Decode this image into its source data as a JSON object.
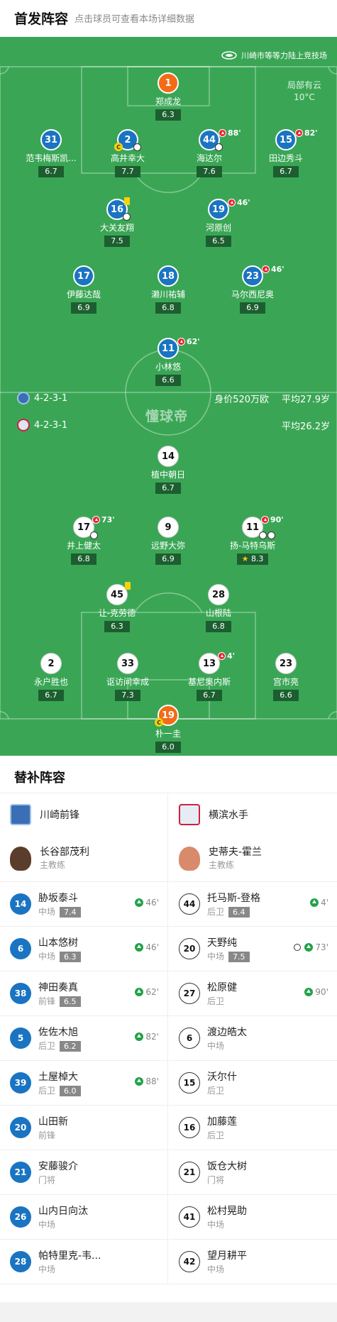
{
  "header": {
    "title": "首发阵容",
    "subtitle": "点击球员可查看本场详细数据"
  },
  "pitch": {
    "venue": "川崎市等等力陆上竞技场",
    "weather": "局部有云",
    "temperature": "10°C",
    "watermark": "懂球帝",
    "home_formation": "4-2-3-1",
    "home_value": "身价520万欧",
    "home_avg_age": "平均27.9岁",
    "away_formation": "4-2-3-1",
    "away_avg_age": "平均26.2岁"
  },
  "home_players": [
    {
      "number": "1",
      "name": "郑成龙",
      "rating": "6.3",
      "gk": true
    },
    {
      "number": "31",
      "name": "范韦梅斯凯...",
      "rating": "6.7"
    },
    {
      "number": "2",
      "name": "高井幸大",
      "rating": "7.7",
      "captain": true,
      "goals": 1
    },
    {
      "number": "44",
      "name": "海达尔",
      "rating": "7.6",
      "sub_off": "88'",
      "goals": 1
    },
    {
      "number": "15",
      "name": "田边秀斗",
      "rating": "6.7",
      "sub_off": "82'"
    },
    {
      "number": "16",
      "name": "大关友翔",
      "rating": "7.5",
      "yellow": true,
      "goals": 1
    },
    {
      "number": "19",
      "name": "河原创",
      "rating": "6.5",
      "sub_off": "46'"
    },
    {
      "number": "17",
      "name": "伊藤达哉",
      "rating": "6.9"
    },
    {
      "number": "18",
      "name": "濑川祐辅",
      "rating": "6.8"
    },
    {
      "number": "23",
      "name": "马尔西尼奥",
      "rating": "6.9",
      "sub_off": "46'"
    },
    {
      "number": "11",
      "name": "小林悠",
      "rating": "6.6",
      "sub_off": "62'"
    }
  ],
  "away_players": [
    {
      "number": "14",
      "name": "植中朝日",
      "rating": "6.7"
    },
    {
      "number": "17",
      "name": "井上健太",
      "rating": "6.8",
      "sub_off": "73'",
      "goals": 1
    },
    {
      "number": "9",
      "name": "远野大弥",
      "rating": "6.9"
    },
    {
      "number": "11",
      "name": "扬-马特乌斯",
      "rating": "8.3",
      "sub_off": "90'",
      "goals": 2,
      "star": true
    },
    {
      "number": "45",
      "name": "让-克劳德",
      "rating": "6.3",
      "yellow": true
    },
    {
      "number": "28",
      "name": "山根陆",
      "rating": "6.8"
    },
    {
      "number": "2",
      "name": "永户胜也",
      "rating": "6.7"
    },
    {
      "number": "33",
      "name": "讴访间幸成",
      "rating": "7.3"
    },
    {
      "number": "13",
      "name": "基尼奥内斯",
      "rating": "6.7",
      "sub_off": "4'"
    },
    {
      "number": "23",
      "name": "宫市亮",
      "rating": "6.6"
    },
    {
      "number": "19",
      "name": "朴一圭",
      "rating": "6.0",
      "gk": true,
      "captain": true
    }
  ],
  "subs": {
    "title": "替补阵容",
    "home": {
      "team": "川崎前锋",
      "coach": "长谷部茂利",
      "coach_role": "主教练",
      "players": [
        {
          "number": "14",
          "name": "胁坂泰斗",
          "pos": "中场",
          "rating": "7.4",
          "min": "46'"
        },
        {
          "number": "6",
          "name": "山本悠树",
          "pos": "中场",
          "rating": "6.3",
          "min": "46'"
        },
        {
          "number": "38",
          "name": "神田奏真",
          "pos": "前锋",
          "rating": "6.5",
          "min": "62'"
        },
        {
          "number": "5",
          "name": "佐佐木旭",
          "pos": "后卫",
          "rating": "6.2",
          "min": "82'"
        },
        {
          "number": "39",
          "name": "土屋棹大",
          "pos": "后卫",
          "rating": "6.0",
          "min": "88'"
        },
        {
          "number": "20",
          "name": "山田新",
          "pos": "前锋"
        },
        {
          "number": "21",
          "name": "安藤骏介",
          "pos": "门将"
        },
        {
          "number": "26",
          "name": "山内日向汰",
          "pos": "中场"
        },
        {
          "number": "28",
          "name": "帕特里克-韦...",
          "pos": "中场"
        }
      ]
    },
    "away": {
      "team": "横滨水手",
      "coach": "史蒂夫-霍兰",
      "coach_role": "主教练",
      "players": [
        {
          "number": "44",
          "name": "托马斯-登格",
          "pos": "后卫",
          "rating": "6.4",
          "min": "4'"
        },
        {
          "number": "20",
          "name": "天野纯",
          "pos": "中场",
          "rating": "7.5",
          "min": "73'",
          "goal": true
        },
        {
          "number": "27",
          "name": "松原健",
          "pos": "后卫",
          "min": "90'"
        },
        {
          "number": "6",
          "name": "渡边皓太",
          "pos": "中场"
        },
        {
          "number": "15",
          "name": "沃尔什",
          "pos": "后卫"
        },
        {
          "number": "16",
          "name": "加藤莲",
          "pos": "后卫"
        },
        {
          "number": "21",
          "name": "饭仓大树",
          "pos": "门将"
        },
        {
          "number": "41",
          "name": "松村晃助",
          "pos": "中场"
        },
        {
          "number": "42",
          "name": "望月耕平",
          "pos": "中场"
        }
      ]
    }
  },
  "colors": {
    "pitch": "#3aa655",
    "home": "#1a74c2",
    "gk": "#f26b16",
    "rating_bg": "#1d5e30"
  }
}
